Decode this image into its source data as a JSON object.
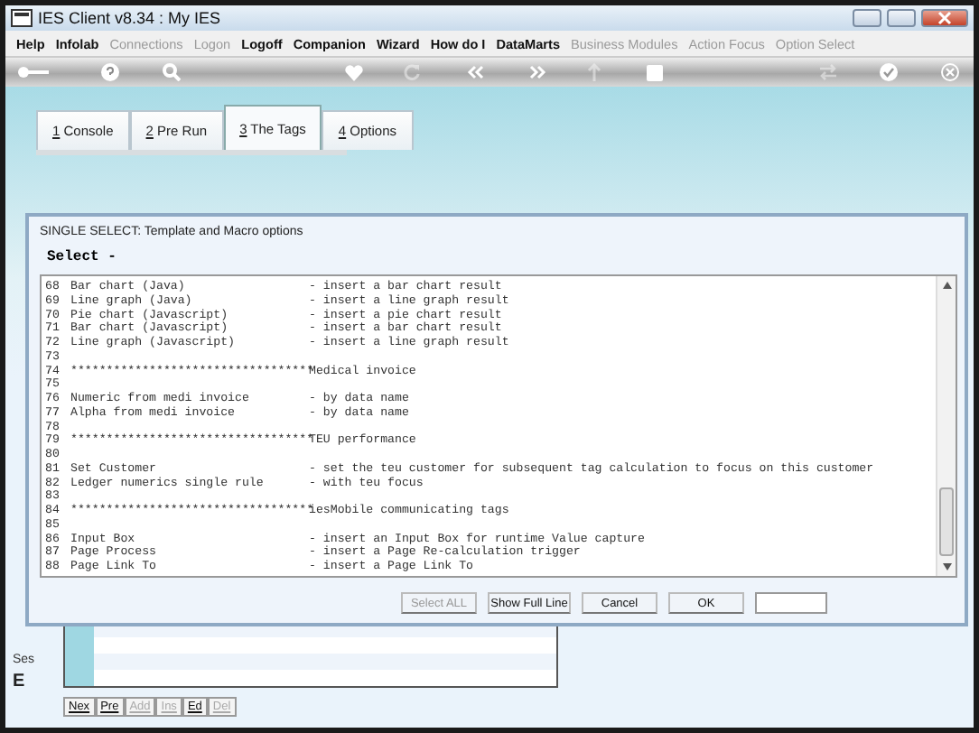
{
  "window": {
    "title": "IES Client v8.34 : My IES"
  },
  "menu": [
    {
      "label": "Help",
      "disabled": false
    },
    {
      "label": "Infolab",
      "disabled": false
    },
    {
      "label": "Connections",
      "disabled": true
    },
    {
      "label": "Logon",
      "disabled": true
    },
    {
      "label": "Logoff",
      "disabled": false
    },
    {
      "label": "Companion",
      "disabled": false
    },
    {
      "label": "Wizard",
      "disabled": false
    },
    {
      "label": "How do I",
      "disabled": false
    },
    {
      "label": "DataMarts",
      "disabled": false
    },
    {
      "label": "Business Modules",
      "disabled": true
    },
    {
      "label": "Action Focus",
      "disabled": true
    },
    {
      "label": "Option Select",
      "disabled": true
    }
  ],
  "toolbar": [
    {
      "kind": "key",
      "disabled": false
    },
    {
      "kind": "help",
      "disabled": false
    },
    {
      "kind": "search",
      "disabled": false
    },
    {
      "kind": "heart",
      "disabled": false
    },
    {
      "kind": "refresh",
      "disabled": true
    },
    {
      "kind": "back",
      "disabled": false
    },
    {
      "kind": "forward",
      "disabled": false
    },
    {
      "kind": "up",
      "disabled": true
    },
    {
      "kind": "stop",
      "disabled": false
    },
    {
      "kind": "swap",
      "disabled": true
    },
    {
      "kind": "check",
      "disabled": false
    },
    {
      "kind": "close",
      "disabled": false
    }
  ],
  "tabs": [
    {
      "label": "1 Console",
      "selected": false
    },
    {
      "label": "2 Pre Run",
      "selected": false
    },
    {
      "label": "3 The Tags",
      "selected": true
    },
    {
      "label": "4 Options",
      "selected": false
    }
  ],
  "background": {
    "label_1": "Ses",
    "label_2": "E",
    "buttons": [
      {
        "label": "Nex",
        "disabled": false
      },
      {
        "label": "Pre",
        "disabled": false
      },
      {
        "label": "Add",
        "disabled": true
      },
      {
        "label": "Ins",
        "disabled": true
      },
      {
        "label": "Ed",
        "disabled": false
      },
      {
        "label": "Del",
        "disabled": true
      }
    ]
  },
  "dialog": {
    "title": "SINGLE SELECT: Template and Macro options",
    "heading": "Select -",
    "lines": [
      {
        "num": "68",
        "name": "Bar chart (Java)",
        "desc": "- insert a bar chart result"
      },
      {
        "num": "69",
        "name": "Line graph (Java)",
        "desc": "- insert a line graph result"
      },
      {
        "num": "70",
        "name": "Pie chart (Javascript)",
        "desc": "- insert a pie chart result"
      },
      {
        "num": "71",
        "name": "Bar chart (Javascript)",
        "desc": "- insert a bar chart result"
      },
      {
        "num": "72",
        "name": "Line graph (Javascript)",
        "desc": "- insert a line graph result"
      },
      {
        "num": "73"
      },
      {
        "num": "74",
        "name": "**********************************",
        "desc": "Medical invoice"
      },
      {
        "num": "75"
      },
      {
        "num": "76",
        "name": "Numeric from medi invoice",
        "desc": "- by data name"
      },
      {
        "num": "77",
        "name": "Alpha from medi invoice",
        "desc": "- by data name"
      },
      {
        "num": "78"
      },
      {
        "num": "79",
        "name": "**********************************",
        "desc": "TEU performance"
      },
      {
        "num": "80"
      },
      {
        "num": "81",
        "name": "Set Customer",
        "desc": "- set the teu customer for subsequent tag calculation to focus on this customer"
      },
      {
        "num": "82",
        "name": "Ledger numerics single rule",
        "desc": "- with teu focus"
      },
      {
        "num": "83"
      },
      {
        "num": "84",
        "name": "**********************************",
        "desc": "iesMobile communicating tags"
      },
      {
        "num": "85"
      },
      {
        "num": "86",
        "name": "Input Box",
        "desc": "- insert an Input Box for runtime Value capture"
      },
      {
        "num": "87",
        "name": "Page Process",
        "desc": "- insert a Page Re-calculation trigger"
      },
      {
        "num": "88",
        "name": "Page Link To",
        "desc": "- insert a Page Link To"
      }
    ],
    "buttons": [
      {
        "label": "Select ALL",
        "disabled": true
      },
      {
        "label": "Show Full Line",
        "disabled": false
      },
      {
        "label": "Cancel",
        "disabled": false
      },
      {
        "label": "OK",
        "disabled": false
      }
    ]
  }
}
